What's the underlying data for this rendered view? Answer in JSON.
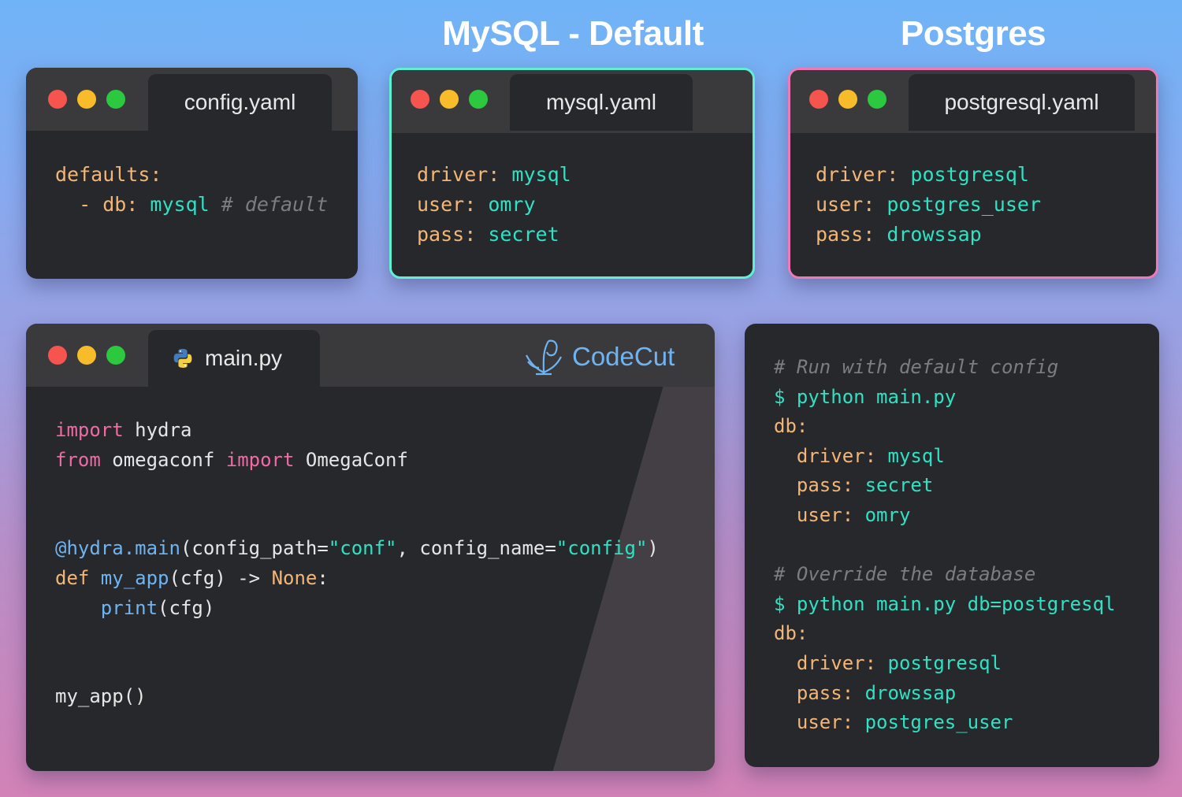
{
  "headings": {
    "mysql": "MySQL - Default",
    "postgres": "Postgres"
  },
  "windows": {
    "config": {
      "tab": "config.yaml",
      "lines": [
        "defaults:",
        "  - db:",
        "mysql",
        "# default"
      ]
    },
    "mysql": {
      "tab": "mysql.yaml",
      "rows": [
        {
          "key": "driver:",
          "value": "mysql"
        },
        {
          "key": "user:",
          "value": "omry"
        },
        {
          "key": "pass:",
          "value": "secret"
        }
      ]
    },
    "postgres": {
      "tab": "postgresql.yaml",
      "rows": [
        {
          "key": "driver:",
          "value": "postgresql"
        },
        {
          "key": "user:",
          "value": "postgres_user"
        },
        {
          "key": "pass:",
          "value": "drowssap"
        }
      ]
    },
    "main": {
      "tab": "main.py",
      "logo_text": "CodeCut",
      "code": {
        "l1_kw": "import",
        "l1_rest": " hydra",
        "l2_kw1": "from",
        "l2_mid": " omegaconf ",
        "l2_kw2": "import",
        "l2_rest": " OmegaConf",
        "l4_dec": "@hydra.main",
        "l4_a": "(config_path=",
        "l4_s1": "\"conf\"",
        "l4_b": ", config_name=",
        "l4_s2": "\"config\"",
        "l4_c": ")",
        "l5_def": "def",
        "l5_fn": " my_app",
        "l5_a": "(cfg) -> ",
        "l5_none": "None",
        "l5_b": ":",
        "l6_ind": "    ",
        "l6_fn": "print",
        "l6_a": "(cfg)",
        "l9": "my_app()"
      }
    },
    "terminal": {
      "comment1": "# Run with default config",
      "cmd1": "$ python main.py",
      "out1_head": "db:",
      "out1": [
        {
          "key": "driver:",
          "value": "mysql"
        },
        {
          "key": "pass:",
          "value": "secret"
        },
        {
          "key": "user:",
          "value": "omry"
        }
      ],
      "comment2": "# Override the database",
      "cmd2": "$ python main.py db=postgresql",
      "out2_head": "db:",
      "out2": [
        {
          "key": "driver:",
          "value": "postgresql"
        },
        {
          "key": "pass:",
          "value": "drowssap"
        },
        {
          "key": "user:",
          "value": "postgres_user"
        }
      ]
    }
  },
  "colors": {
    "key": "#f3b676",
    "value": "#2ee2c4",
    "keyword": "#f06aa6",
    "function": "#6fb4f2",
    "comment": "#7c7c82",
    "mysql_border": "#5ff0d3",
    "postgres_border": "#ef79b7"
  }
}
